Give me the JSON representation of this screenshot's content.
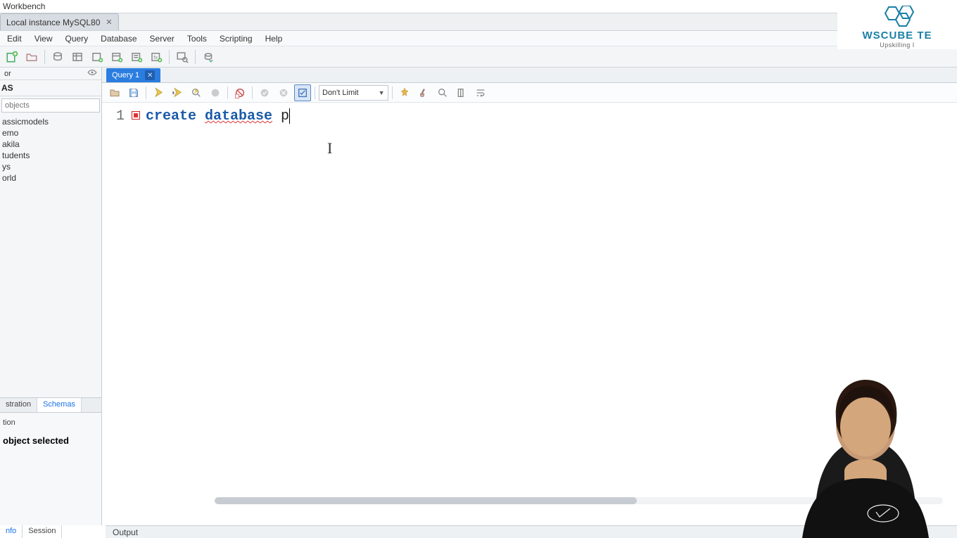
{
  "app_title": "Workbench",
  "connection_tab": "Local instance MySQL80",
  "menu": [
    "Edit",
    "View",
    "Query",
    "Database",
    "Server",
    "Tools",
    "Scripting",
    "Help"
  ],
  "navigator_label": "or",
  "schemas_header": "AS",
  "filter_placeholder": "objects",
  "schemas": [
    "assicmodels",
    "emo",
    "akila",
    "tudents",
    "ys",
    "orld"
  ],
  "side_tabs": {
    "admin": "stration",
    "schemas": "Schemas"
  },
  "info_line": "tion",
  "no_object": "object selected",
  "query_tab": "Query 1",
  "limit_combo": "Don't Limit",
  "code": {
    "line_no": "1",
    "token_create": "create",
    "token_database": "database",
    "token_rest": " p"
  },
  "output_label": "Output",
  "bottom_tabs": {
    "info": "nfo",
    "session": "Session"
  },
  "brand": {
    "line1": "WSCUBE TE",
    "line2": "Upskilling I"
  }
}
